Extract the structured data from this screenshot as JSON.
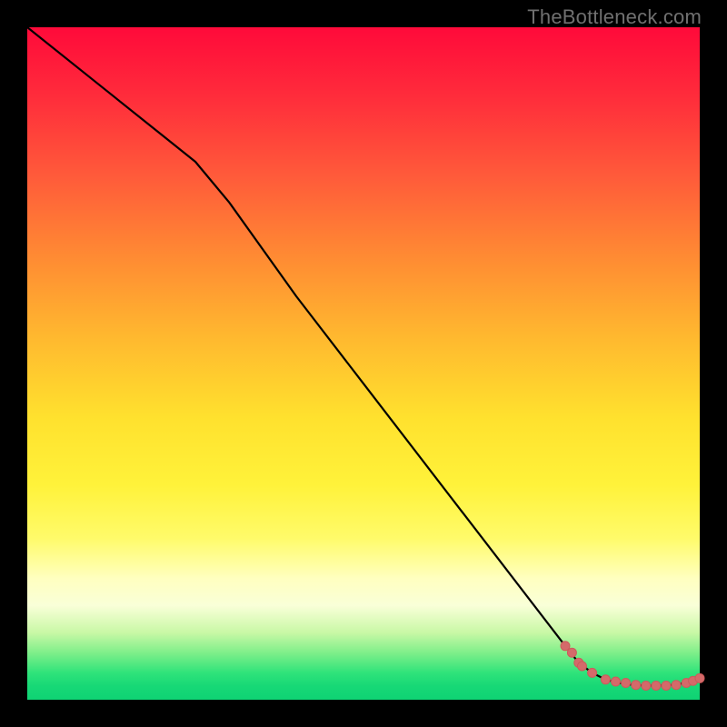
{
  "watermark": "TheBottleneck.com",
  "colors": {
    "line": "#000000",
    "marker_fill": "#d46a6a",
    "marker_stroke": "#cc5b5b"
  },
  "chart_data": {
    "type": "line",
    "title": "",
    "xlabel": "",
    "ylabel": "",
    "xlim": [
      0,
      100
    ],
    "ylim": [
      0,
      100
    ],
    "series": [
      {
        "name": "curve",
        "x": [
          0,
          10,
          20,
          25,
          30,
          40,
          50,
          60,
          70,
          80,
          82,
          84,
          86,
          88,
          90,
          92,
          94,
          96,
          98,
          100
        ],
        "values": [
          100,
          92,
          84,
          80,
          74,
          60,
          47,
          34,
          21,
          8,
          5.5,
          4,
          3,
          2.5,
          2.2,
          2.1,
          2.1,
          2.2,
          2.5,
          3.2
        ]
      }
    ],
    "markers": {
      "name": "dots",
      "x": [
        80,
        81,
        82,
        82.5,
        84,
        86,
        87.5,
        89,
        90.5,
        92,
        93.5,
        95,
        96.5,
        98,
        99,
        100
      ],
      "values": [
        8,
        7,
        5.5,
        5,
        4,
        3,
        2.7,
        2.5,
        2.2,
        2.1,
        2.1,
        2.1,
        2.2,
        2.5,
        2.8,
        3.2
      ]
    }
  }
}
